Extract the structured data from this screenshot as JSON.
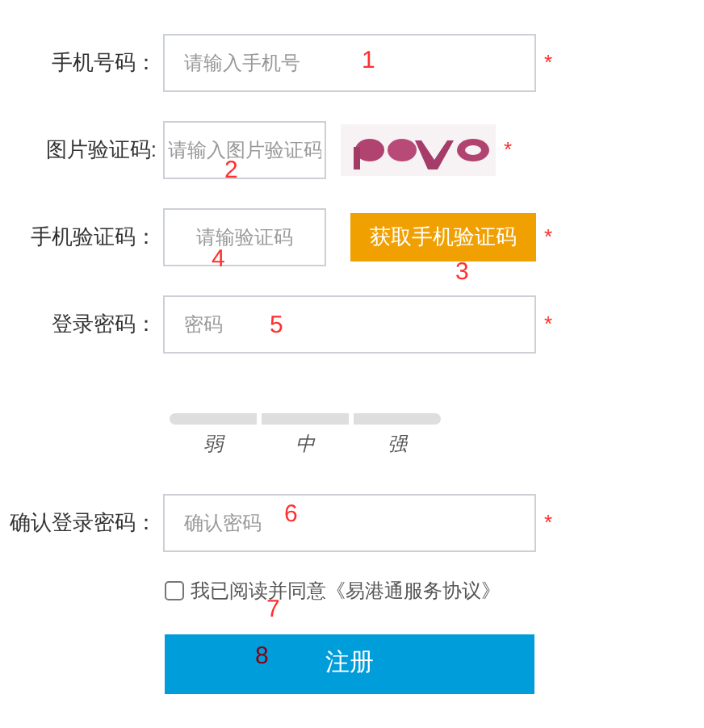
{
  "fields": [
    {
      "kind": "text",
      "label": "手机号码：",
      "placeholder": "请输入手机号",
      "mark": "*"
    },
    {
      "kind": "captcha",
      "label": "图片验证码:",
      "placeholder": "请输入图片验证码",
      "mark": "*"
    },
    {
      "kind": "sms",
      "label": "手机验证码：",
      "placeholder": "请输验证码",
      "button": "获取手机验证码",
      "mark": "*"
    },
    {
      "kind": "password",
      "label": "登录密码：",
      "placeholder": "密码",
      "mark": "*"
    },
    {
      "kind": "strength",
      "levels": [
        "弱",
        "中",
        "强"
      ]
    },
    {
      "kind": "text",
      "label": "确认登录密码：",
      "placeholder": "确认密码",
      "mark": "*"
    }
  ],
  "agreement": {
    "checked": false,
    "text": "我已阅读并同意《易港通服务协议》"
  },
  "submit": "注册",
  "annotations": [
    "1",
    "2",
    "3",
    "4",
    "5",
    "6",
    "7",
    "8"
  ]
}
